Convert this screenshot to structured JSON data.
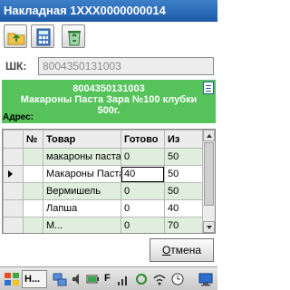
{
  "window": {
    "title": "Накладная 1XXX0000000014"
  },
  "toolbar": {
    "buttons": [
      "folder-up-icon",
      "calculator-icon",
      "recycle-bin-icon"
    ]
  },
  "barcode": {
    "label": "ШК:",
    "value": "8004350131003"
  },
  "product_info": {
    "code": "8004350131003",
    "name_line1": "Макароны Паста Зара №100 клубки",
    "name_line2": "500г.",
    "address_label": "Адрес:"
  },
  "grid": {
    "headers": [
      "№",
      "Товар",
      "Готово",
      "Из"
    ],
    "rows": [
      {
        "num": "",
        "item": "макароны паста",
        "done": "0",
        "of": "50"
      },
      {
        "num": "",
        "item": "Макароны Паста",
        "done": "40",
        "of": "50"
      },
      {
        "num": "",
        "item": "Вермишель",
        "done": "0",
        "of": "50"
      },
      {
        "num": "",
        "item": "Лапша",
        "done": "0",
        "of": "40"
      },
      {
        "num": "",
        "item": "М...",
        "done": "0",
        "of": "70"
      }
    ]
  },
  "buttons": {
    "cancel_prefix": "",
    "cancel_underlined": "О",
    "cancel_rest": "тмена"
  },
  "taskbar": {
    "task_label": "Н...",
    "kbd_letter": "F"
  },
  "colors": {
    "titlebar": "#1c5aa8",
    "info_panel": "#55c35a",
    "alt_row": "#dfeedd"
  }
}
